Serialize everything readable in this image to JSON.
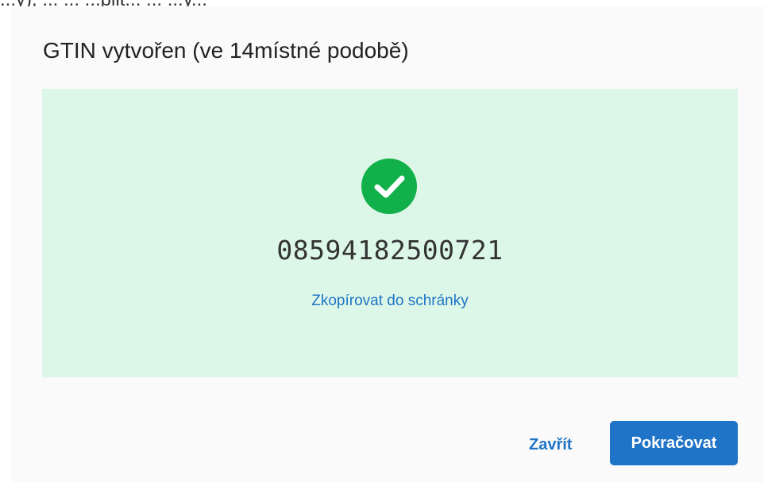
{
  "top_cropped_text": "...y), ... ... ...plit... ... ...y...",
  "dialog": {
    "title": "GTIN vytvořen (ve 14místné podobě)",
    "result": {
      "status_icon": "check-circle-icon",
      "gtin": "08594182500721",
      "copy_link_label": "Zkopírovat do schránky"
    },
    "actions": {
      "close_label": "Zavřít",
      "continue_label": "Pokračovat"
    }
  },
  "colors": {
    "accent": "#1f74c7",
    "success": "#12b04b",
    "panel_background": "#dcf7e7"
  }
}
